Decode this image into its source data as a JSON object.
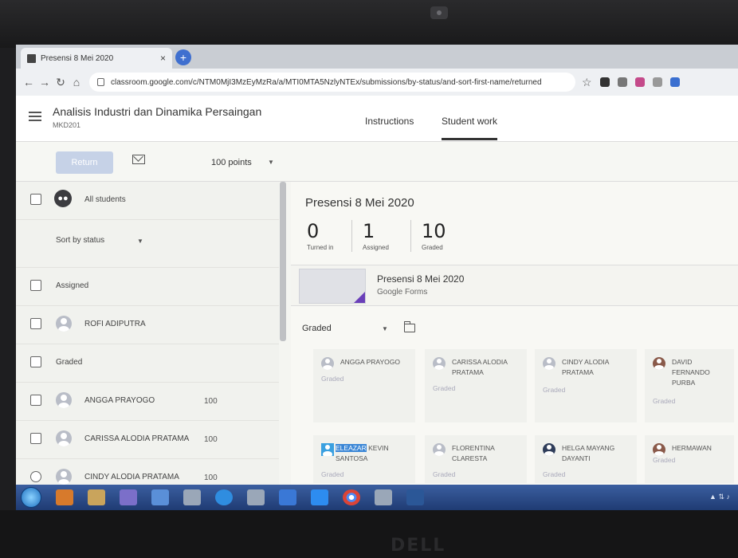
{
  "browser": {
    "tab_title": "Presensi 8 Mei 2020",
    "tab_close": "×",
    "new_tab": "+",
    "url": "classroom.google.com/c/NTM0MjI3MzEyMzRa/a/MTI0MTA5NzlyNTEx/submissions/by-status/and-sort-first-name/returned",
    "star": "☆"
  },
  "classroom": {
    "course_title": "Analisis Industri dan Dinamika Persaingan",
    "course_code": "MKD201",
    "tabs": [
      "Instructions",
      "Student work"
    ],
    "active_tab": "Student work"
  },
  "actions": {
    "return_label": "Return",
    "points": "100 points"
  },
  "roster": {
    "all_students": "All students",
    "sort_label": "Sort by status",
    "sections": [
      {
        "label": "Assigned",
        "students": [
          {
            "name": "ROFI ADIPUTRA",
            "grade": ""
          }
        ]
      },
      {
        "label": "Graded",
        "students": [
          {
            "name": "ANGGA PRAYOGO",
            "grade": "100"
          },
          {
            "name": "CARISSA ALODIA PRATAMA",
            "grade": "100"
          },
          {
            "name": "CINDY ALODIA PRATAMA",
            "grade": "100"
          }
        ]
      }
    ]
  },
  "assignment": {
    "title": "Presensi 8 Mei 2020",
    "stats": [
      {
        "value": "0",
        "label": "Turned in"
      },
      {
        "value": "1",
        "label": "Assigned"
      },
      {
        "value": "10",
        "label": "Graded"
      }
    ],
    "attachment": {
      "title": "Presensi 8 Mei 2020",
      "subtitle": "Google Forms"
    },
    "filter": "Graded",
    "cards": [
      {
        "name": "ANGGA PRAYOGO",
        "status": "Graded"
      },
      {
        "name": "CARISSA ALODIA PRATAMA",
        "status": "Graded"
      },
      {
        "name": "CINDY ALODIA PRATAMA",
        "status": "Graded"
      },
      {
        "name": "DAVID FERNANDO PURBA",
        "status": "Graded"
      },
      {
        "name_highlight": "ELEAZAR",
        "name": "KEVIN SANTOSA",
        "status": "Graded"
      },
      {
        "name": "FLORENTINA CLARESTA",
        "status": "Graded"
      },
      {
        "name": "HELGA MAYANG DAYANTI",
        "status": "Graded"
      },
      {
        "name": "HERMAWAN",
        "status": "Graded"
      }
    ]
  },
  "device": {
    "brand": "DELL"
  },
  "colors": {
    "return_button": "#c6d2e7",
    "forms_accent": "#6a3fb9",
    "taskbar": "#2a4c8c"
  }
}
